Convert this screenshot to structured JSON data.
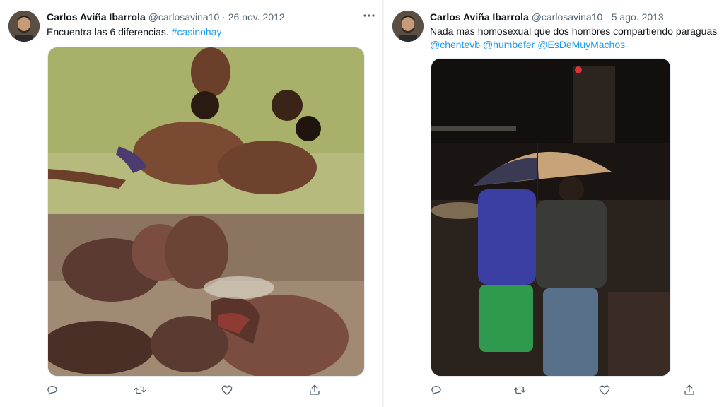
{
  "tweets": [
    {
      "author_name": "Carlos Aviña Ibarrola",
      "handle": "@carlosavina10",
      "separator": "·",
      "date": "26 nov. 2012",
      "text_plain": "Encuentra las 6 diferencias. ",
      "hashtag": "#casinohay",
      "more_icon": "more-horizontal-icon"
    },
    {
      "author_name": "Carlos Aviña Ibarrola",
      "handle": "@carlosavina10",
      "separator": "·",
      "date": "5 ago. 2013",
      "text_plain": "Nada más homosexual que dos hombres compartiendo paraguas",
      "mention_1": "@chentevb",
      "mention_2": "@humbefer",
      "mention_3": "@EsDeMuyMachos"
    }
  ],
  "action_icons": [
    "reply-icon",
    "retweet-icon",
    "like-icon",
    "share-icon"
  ],
  "colors": {
    "link": "#1d9bf0",
    "secondary_text": "#536471",
    "icon": "#536471"
  }
}
